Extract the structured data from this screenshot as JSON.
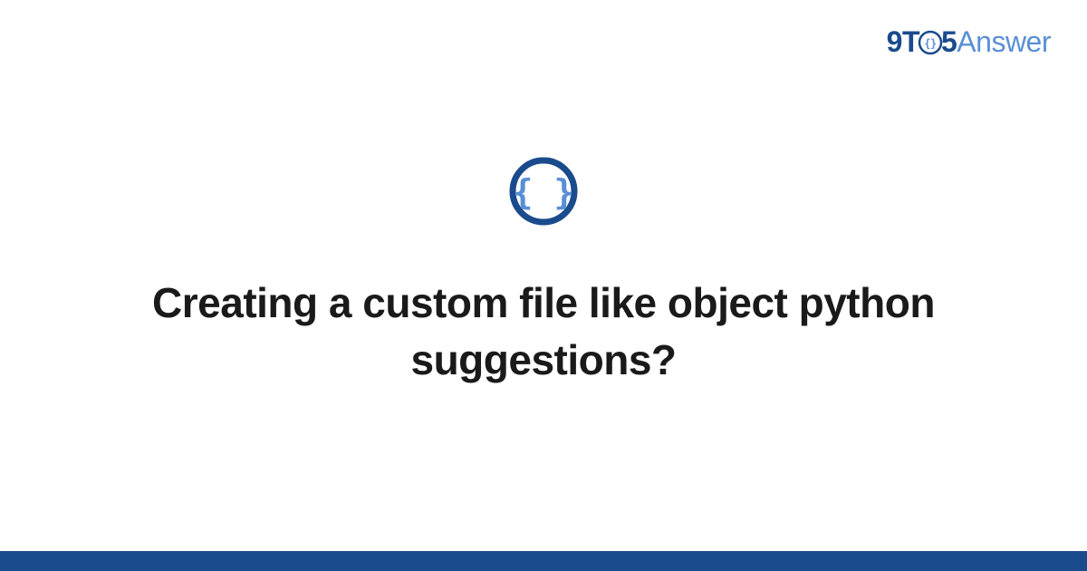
{
  "brand": {
    "part1": "9T",
    "part2": "5",
    "part3": "Answer"
  },
  "main": {
    "title": "Creating a custom file like object python suggestions?",
    "icon_name": "code-braces-icon"
  },
  "colors": {
    "primary": "#1a4b8c",
    "secondary": "#5a8fd6"
  }
}
